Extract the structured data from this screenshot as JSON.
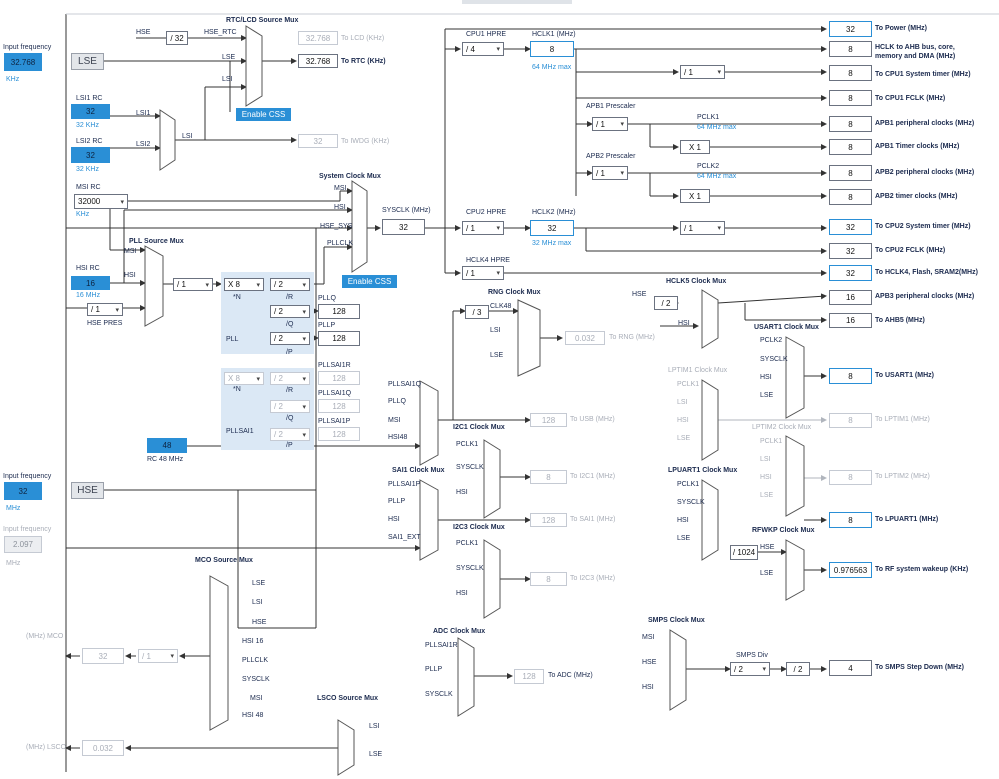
{
  "inputs": {
    "lse": {
      "label": "Input frequency",
      "value": "32.768",
      "unit": "KHz",
      "block": "LSE"
    },
    "hse": {
      "label": "Input frequency",
      "value": "32",
      "unit": "MHz",
      "block": "HSE"
    },
    "ext": {
      "label": "Input frequency",
      "value": "2.097",
      "unit": "MHz"
    }
  },
  "oscillators": {
    "lsi1": {
      "title": "LSI1 RC",
      "value": "32",
      "unit": "32 KHz"
    },
    "lsi2": {
      "title": "LSI2 RC",
      "value": "32",
      "unit": "32 KHz"
    },
    "msi": {
      "title": "MSI RC",
      "value": "32000",
      "unit": "KHz"
    },
    "hsi": {
      "title": "HSI RC",
      "value": "16",
      "unit": "16 MHz"
    },
    "rc48": {
      "value": "48",
      "unit": "RC 48 MHz"
    }
  },
  "rtc": {
    "title": "RTC/LCD Source Mux",
    "hse_label": "HSE",
    "div": "/ 32",
    "hse_rtc": "HSE_RTC",
    "lse": "LSE",
    "lsi": "LSI",
    "lcd_value": "32.768",
    "lcd_label": "To LCD (KHz)",
    "rtc_value": "32.768",
    "rtc_label": "To RTC (KHz)",
    "css": "Enable CSS",
    "iwdg_value": "32",
    "iwdg_label": "To IWDG (KHz)",
    "lsi1": "LSI1",
    "lsi2": "LSI2"
  },
  "system_mux": {
    "title": "System Clock Mux",
    "msi": "MSI",
    "hsi": "HSI",
    "hse_sys": "HSE_SYS",
    "pllclk": "PLLCLK",
    "sysclk_label": "SYSCLK (MHz)",
    "sysclk_value": "32",
    "css": "Enable CSS"
  },
  "pll": {
    "title": "PLL Source Mux",
    "msi": "MSI",
    "hsi": "HSI",
    "hse": "HSE",
    "hse_pres": "HSE PRES",
    "pres_value": "/ 1",
    "pllm_label": "PLLM",
    "pllm_value": "/ 1",
    "n_value": "X 8",
    "n_label": "*N",
    "r_value": "/ 2",
    "r_label": "/R",
    "q_value": "/ 2",
    "q_label": "/Q",
    "p_value": "/ 2",
    "p_label": "/P",
    "pll_label": "PLL",
    "pllq_label": "PLLQ",
    "pllq_value": "128",
    "pllp_label": "PLLP",
    "pllp_value": "128"
  },
  "pllsai1": {
    "n_value": "X 8",
    "n_label": "*N",
    "r_value": "/ 2",
    "r_label": "/R",
    "q_value": "/ 2",
    "q_label": "/Q",
    "p_value": "/ 2",
    "p_label": "/P",
    "label": "PLLSAI1",
    "r_out_label": "PLLSAI1R",
    "r_out": "128",
    "q_out_label": "PLLSAI1Q",
    "q_out": "128",
    "p_out_label": "PLLSAI1P",
    "p_out": "128"
  },
  "cpu": {
    "cpu1_label": "CPU1 HPRE",
    "cpu1_value": "/ 4",
    "hclk1_label": "HCLK1 (MHz)",
    "hclk1_value": "8",
    "hclk1_max": "64 MHz max",
    "apb1_label": "APB1 Prescaler",
    "apb1_value": "/ 1",
    "pclk1_label": "PCLK1",
    "pclk1_max": "64 MHz max",
    "apb1_timer_mult": "X 1",
    "apb2_label": "APB2 Prescaler",
    "apb2_value": "/ 1",
    "pclk2_label": "PCLK2",
    "pclk2_max": "64 MHz max",
    "apb2_timer_mult": "X 1",
    "cpu1_timer_div": "/ 1",
    "cpu2_label": "CPU2 HPRE",
    "cpu2_value": "/ 1",
    "hclk2_label": "HCLK2 (MHz)",
    "hclk2_value": "32",
    "hclk2_max": "32 MHz max",
    "cpu2_timer_div": "/ 1",
    "hclk4_label": "HCLK4 HPRE",
    "hclk4_value": "/ 1"
  },
  "outputs": [
    {
      "value": "32",
      "label": "To Power (MHz)"
    },
    {
      "value": "8",
      "label": "HCLK to AHB bus, core,",
      "label2": "memory and DMA (MHz)"
    },
    {
      "value": "8",
      "label": "To CPU1 System timer (MHz)"
    },
    {
      "value": "8",
      "label": "To CPU1 FCLK (MHz)"
    },
    {
      "value": "8",
      "label": "APB1 peripheral clocks (MHz)"
    },
    {
      "value": "8",
      "label": "APB1 Timer clocks (MHz)"
    },
    {
      "value": "8",
      "label": "APB2 peripheral clocks (MHz)"
    },
    {
      "value": "8",
      "label": "APB2 timer clocks (MHz)"
    },
    {
      "value": "32",
      "label": "To CPU2 System timer (MHz)"
    },
    {
      "value": "32",
      "label": "To CPU2 FCLK (MHz)"
    },
    {
      "value": "32",
      "label": "To HCLK4, Flash, SRAM2(MHz)"
    }
  ],
  "hclk5": {
    "title": "HCLK5 Clock Mux",
    "hse": "HSE",
    "div": "/ 2",
    "hsi": "HSI",
    "apb3_value": "16",
    "apb3_label": "APB3 peripheral clocks (MHz)",
    "ahb5_value": "16",
    "ahb5_label": "To AHB5 (MHz)"
  },
  "rng": {
    "title": "RNG Clock Mux",
    "div": "/ 3",
    "clk48": "CLK48",
    "lsi": "LSI",
    "lse": "LSE",
    "value": "0.032",
    "label": "To RNG (MHz)"
  },
  "usb": {
    "pllsai1q": "PLLSAI1Q",
    "pllq": "PLLQ",
    "msi": "MSI",
    "hsi48": "HSI48",
    "title": "I2C1 Clock Mux",
    "value": "128",
    "label": "To USB (MHz)"
  },
  "i2c1": {
    "pclk1": "PCLK1",
    "sysclk": "SYSCLK",
    "hsi": "HSI",
    "value": "8",
    "label": "To I2C1 (MHz)"
  },
  "sai1": {
    "title": "SAI1 Clock Mux",
    "pllsai1p": "PLLSAI1P",
    "pllp": "PLLP",
    "hsi": "HSI",
    "ext": "SAI1_EXT",
    "value": "128",
    "label": "To SAI1 (MHz)"
  },
  "i2c3": {
    "title": "I2C3 Clock Mux",
    "pclk1": "PCLK1",
    "sysclk": "SYSCLK",
    "hsi": "HSI",
    "value": "8",
    "label": "To I2C3 (MHz)"
  },
  "adc": {
    "title": "ADC Clock Mux",
    "pllsai1r": "PLLSAI1R",
    "pllp": "PLLP",
    "sysclk": "SYSCLK",
    "value": "128",
    "label": "To ADC (MHz)"
  },
  "usart1": {
    "title": "USART1 Clock Mux",
    "pclk2": "PCLK2",
    "sysclk": "SYSCLK",
    "hsi": "HSI",
    "lse": "LSE",
    "value": "8",
    "label": "To USART1 (MHz)"
  },
  "lptim1": {
    "title": "LPTIM1 Clock Mux",
    "pclk1": "PCLK1",
    "lsi": "LSI",
    "hsi": "HSI",
    "lse": "LSE",
    "value": "8",
    "label": "To LPTIM1 (MHz)"
  },
  "lptim2": {
    "title": "LPTIM2 Clock Mux",
    "pclk1": "PCLK1",
    "lsi": "LSI",
    "hsi": "HSI",
    "lse": "LSE",
    "value": "8",
    "label": "To LPTIM2 (MHz)"
  },
  "lpuart1": {
    "title": "LPUART1 Clock Mux",
    "pclk1": "PCLK1",
    "sysclk": "SYSCLK",
    "hsi": "HSI",
    "lse": "LSE",
    "value": "8",
    "label": "To LPUART1 (MHz)"
  },
  "rfwkp": {
    "title": "RFWKP Clock Mux",
    "div": "/ 1024",
    "hse": "HSE",
    "lse": "LSE",
    "value": "0.976563",
    "label": "To RF system wakeup (KHz)"
  },
  "smps": {
    "title": "SMPS Clock Mux",
    "msi": "MSI",
    "hse": "HSE",
    "hsi": "HSI",
    "div_label": "SMPS Div",
    "div_value": "/ 2",
    "div2": "/ 2",
    "value": "4",
    "label": "To SMPS Step Down (MHz)"
  },
  "mco": {
    "title": "MCO Source Mux",
    "items": [
      "LSE",
      "LSI",
      "HSE",
      "HSI 16",
      "PLLCLK",
      "SYSCLK",
      "MSI",
      "HSI 48"
    ],
    "div": "/ 1",
    "value": "32",
    "label": "(MHz) MCO"
  },
  "lsco": {
    "title": "LSCO Source Mux",
    "lsi": "LSI",
    "lse": "LSE",
    "value": "0.032",
    "label": "(MHz) LSCO"
  }
}
